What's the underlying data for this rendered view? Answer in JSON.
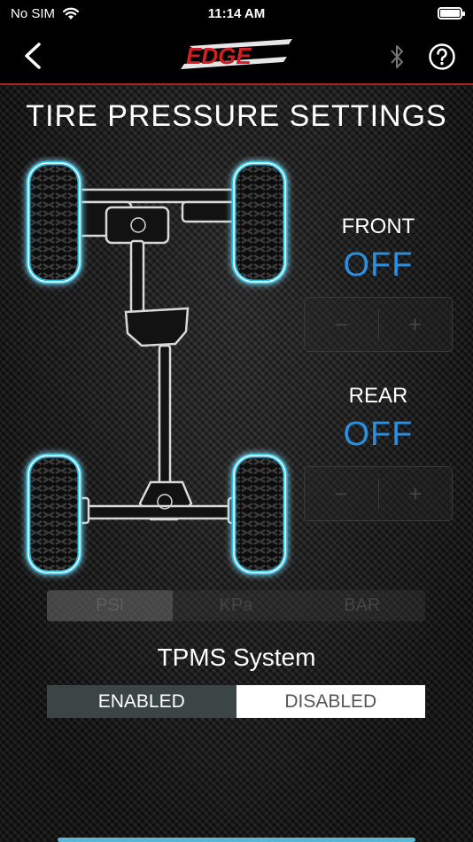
{
  "status_bar": {
    "carrier": "No SIM",
    "time": "11:14 AM"
  },
  "nav": {
    "logo_text": "EDGE"
  },
  "page_title": "TIRE PRESSURE SETTINGS",
  "front": {
    "label": "FRONT",
    "value": "OFF",
    "minus": "−",
    "plus": "+"
  },
  "rear": {
    "label": "REAR",
    "value": "OFF",
    "minus": "−",
    "plus": "+"
  },
  "units": {
    "options": [
      "PSI",
      "KPa",
      "BAR"
    ],
    "selected": "PSI"
  },
  "tpms": {
    "label": "TPMS System",
    "enabled_label": "ENABLED",
    "disabled_label": "DISABLED",
    "selected": "ENABLED"
  },
  "colors": {
    "accent_blue": "#2b8fe0",
    "tire_glow": "#29c4ea",
    "nav_divider": "#b0201c",
    "toggle_selected": "#3c4546"
  }
}
